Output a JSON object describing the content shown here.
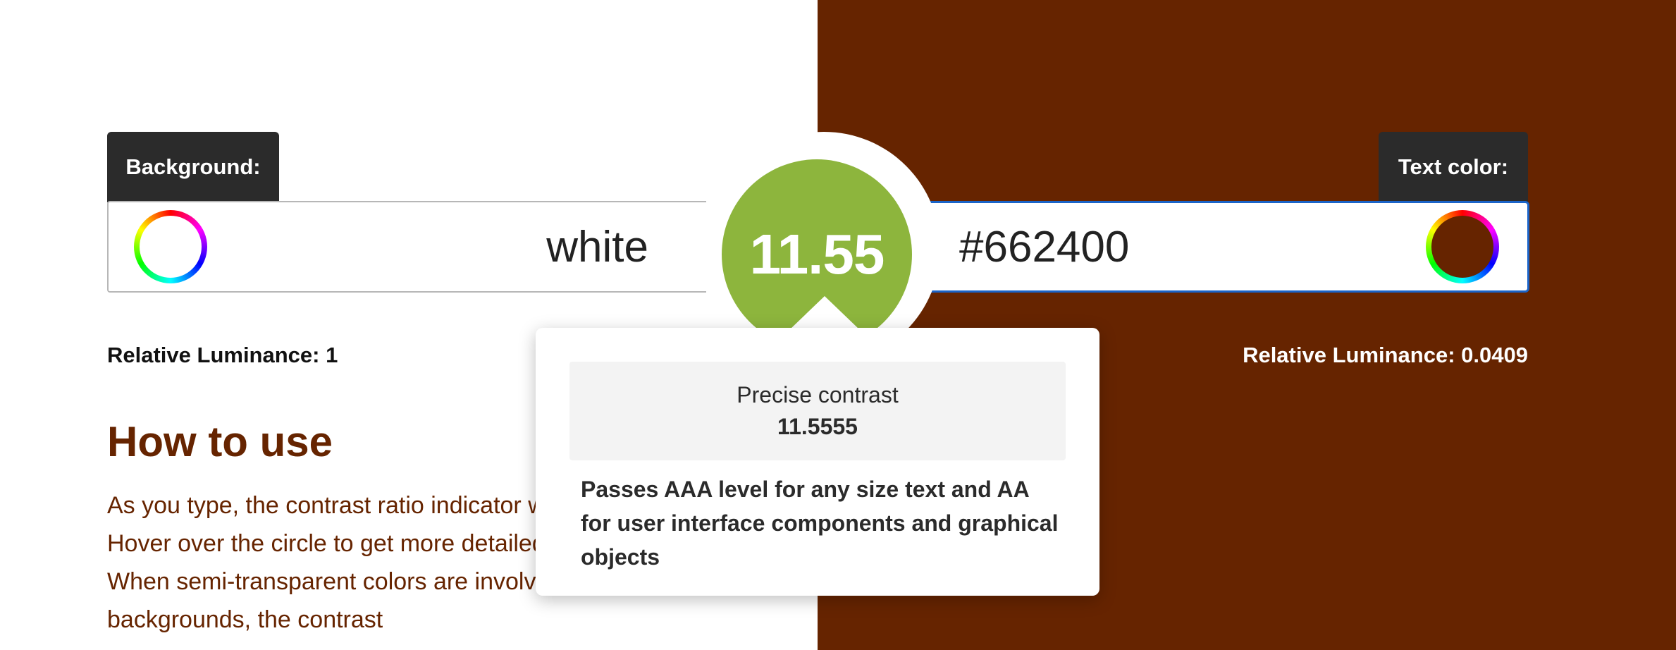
{
  "background": {
    "label": "Background:",
    "value": "white",
    "relative_luminance_label": "Relative Luminance:",
    "relative_luminance_value": "1"
  },
  "text_color": {
    "label": "Text color:",
    "value": "#662400",
    "relative_luminance_label": "Relative Luminance:",
    "relative_luminance_value": "0.0409"
  },
  "contrast": {
    "ratio": "11.55",
    "precise_label": "Precise contrast",
    "precise_value": "11.5555",
    "message": "Passes AAA level for any size text and AA for user interface components and graphical objects"
  },
  "how_to_use": {
    "title": "How to use",
    "body": "As you type, the contrast ratio indicator will update. Hover over the circle to get more detailed information. When semi-transparent colors are involved as backgrounds, the contrast"
  },
  "colors": {
    "background_color": "#ffffff",
    "text_color": "#662400",
    "ratio_circle": "#8db53d",
    "focus_border": "#1b64c8",
    "label_tab": "#2b2b2b"
  },
  "icons": {
    "background_picker": "color-wheel-icon",
    "text_picker": "color-wheel-icon"
  }
}
